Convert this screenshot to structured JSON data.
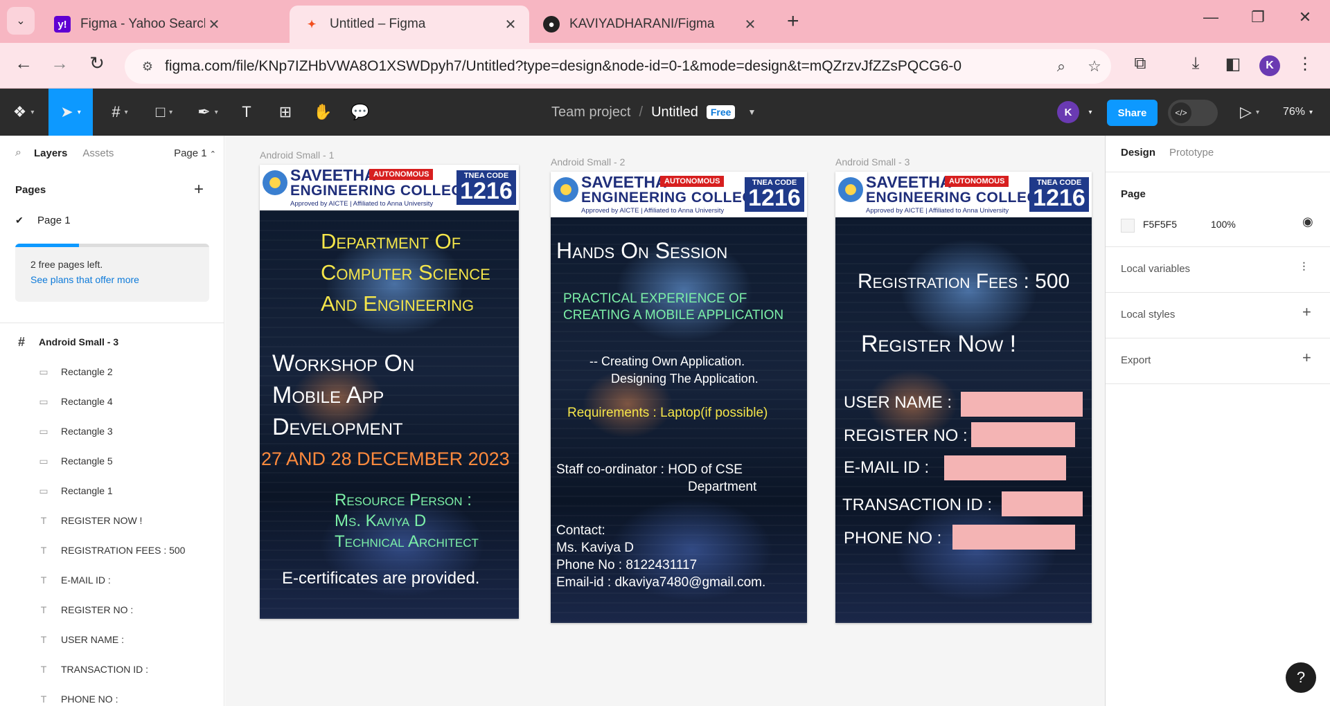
{
  "browser": {
    "tabs": [
      {
        "title": "Figma - Yahoo Search Results",
        "icon": "yahoo-icon",
        "active": false
      },
      {
        "title": "Untitled – Figma",
        "icon": "figma-icon",
        "active": true
      },
      {
        "title": "KAVIYADHARANI/Figma",
        "icon": "github-icon",
        "active": false
      }
    ],
    "url": "figma.com/file/KNp7IZHbVWA8O1XSWDpyh7/Untitled?type=design&node-id=0-1&mode=design&t=mQZrzvJfZZsPQCG6-0",
    "profile_initial": "K"
  },
  "toolbar": {
    "team": "Team project",
    "file_name": "Untitled",
    "plan_badge": "Free",
    "avatar_initial": "K",
    "share_label": "Share",
    "zoom": "76%"
  },
  "left_panel": {
    "tabs": {
      "layers": "Layers",
      "assets": "Assets"
    },
    "page_selector": "Page 1",
    "pages_heading": "Pages",
    "pages": [
      "Page 1"
    ],
    "free_pages_msg": "2 free pages left.",
    "free_pages_fraction": 0.33,
    "plans_link": "See plans that offer more",
    "layers": [
      {
        "name": "Android Small - 3",
        "type": "frame"
      },
      {
        "name": "Rectangle 2",
        "type": "rect"
      },
      {
        "name": "Rectangle 4",
        "type": "rect"
      },
      {
        "name": "Rectangle 3",
        "type": "rect"
      },
      {
        "name": "Rectangle 5",
        "type": "rect"
      },
      {
        "name": "Rectangle 1",
        "type": "rect"
      },
      {
        "name": "REGISTER NOW !",
        "type": "text"
      },
      {
        "name": "REGISTRATION FEES : 500",
        "type": "text"
      },
      {
        "name": "E-MAIL ID :",
        "type": "text"
      },
      {
        "name": "REGISTER NO :",
        "type": "text"
      },
      {
        "name": "USER NAME :",
        "type": "text"
      },
      {
        "name": "TRANSACTION ID :",
        "type": "text"
      },
      {
        "name": "PHONE NO :",
        "type": "text"
      }
    ]
  },
  "canvas": {
    "header": {
      "college_line1": "SAVEETHA",
      "college_line2": "ENGINEERING COLLEGE",
      "approval": "Approved by AICTE | Affiliated to Anna University",
      "autonomous": "AUTONOMOUS",
      "tnea_label": "TNEA CODE",
      "tnea_code": "1216"
    },
    "frame1": {
      "label": "Android Small - 1",
      "dept": [
        "Department Of",
        "Computer Science",
        "And Engineering"
      ],
      "workshop": [
        "Workshop On",
        "Mobile App",
        "Development"
      ],
      "dates": "27 AND 28 DECEMBER 2023",
      "resource": [
        "Resource Person :",
        "Ms. Kaviya D",
        "Technical Architect"
      ],
      "certificates": "E-certificates are provided."
    },
    "frame2": {
      "label": "Android Small - 2",
      "title": "Hands On Session",
      "practical": [
        "PRACTICAL EXPERIENCE OF",
        "CREATING A MOBILE APPLICATION"
      ],
      "points": [
        "--  Creating Own Application.",
        "Designing The Application."
      ],
      "requirements": "Requirements : Laptop(if possible)",
      "staff": [
        "Staff co-ordinator : HOD of CSE",
        "Department"
      ],
      "contact": [
        "Contact:",
        "Ms. Kaviya D",
        "Phone No : 8122431117",
        "Email-id : dkaviya7480@gmail.com."
      ]
    },
    "frame3": {
      "label": "Android Small - 3",
      "fees": "Registration Fees : 500",
      "register": "Register Now !",
      "fields": [
        "USER NAME :",
        "REGISTER NO :",
        "E-MAIL ID :",
        "TRANSACTION ID :",
        "PHONE NO :"
      ]
    }
  },
  "right_panel": {
    "tabs": {
      "design": "Design",
      "prototype": "Prototype"
    },
    "page_heading": "Page",
    "page_color": "F5F5F5",
    "page_opacity": "100%",
    "local_variables": "Local variables",
    "local_styles": "Local styles",
    "export": "Export"
  },
  "colors": {
    "figma_blue": "#0d99ff",
    "toolbar_bg": "#2c2c2c",
    "tab_strip": "#f7b6c2",
    "poster_yellow": "#f5e64a",
    "poster_green": "#7cf0a8",
    "poster_orange": "#ff8a3d",
    "field_pink": "#f4b4b4"
  },
  "help_label": "?"
}
